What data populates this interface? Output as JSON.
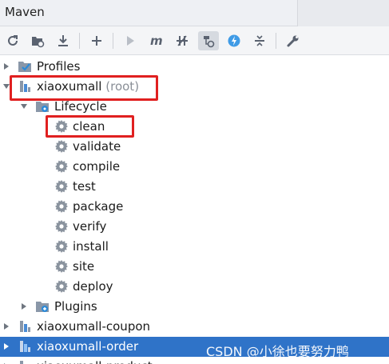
{
  "panel": {
    "title": "Maven"
  },
  "toolbar": {
    "buttons": [
      {
        "icon": "reload-icon"
      },
      {
        "icon": "generate-sources-icon"
      },
      {
        "icon": "download-icon"
      },
      {
        "icon": "add-icon"
      },
      {
        "icon": "run-icon"
      },
      {
        "icon": "maven-goal-icon"
      },
      {
        "icon": "skip-tests-icon"
      },
      {
        "icon": "show-dependencies-icon"
      },
      {
        "icon": "offline-mode-icon"
      },
      {
        "icon": "collapse-all-icon"
      },
      {
        "icon": "settings-wrench-icon"
      }
    ]
  },
  "tree": {
    "profiles": "Profiles",
    "root_project": "xiaoxumall",
    "root_suffix": "(root)",
    "lifecycle": "Lifecycle",
    "goals": [
      "clean",
      "validate",
      "compile",
      "test",
      "package",
      "verify",
      "install",
      "site",
      "deploy"
    ],
    "plugins": "Plugins",
    "modules": [
      "xiaoxumall-coupon",
      "xiaoxumall-order",
      "xiaoxumall-product"
    ],
    "selected_module": "xiaoxumall-order"
  },
  "watermark": "CSDN @小徐也要努力鸭",
  "colors": {
    "highlight_box": "#e02020",
    "selection": "#2f73c8"
  }
}
